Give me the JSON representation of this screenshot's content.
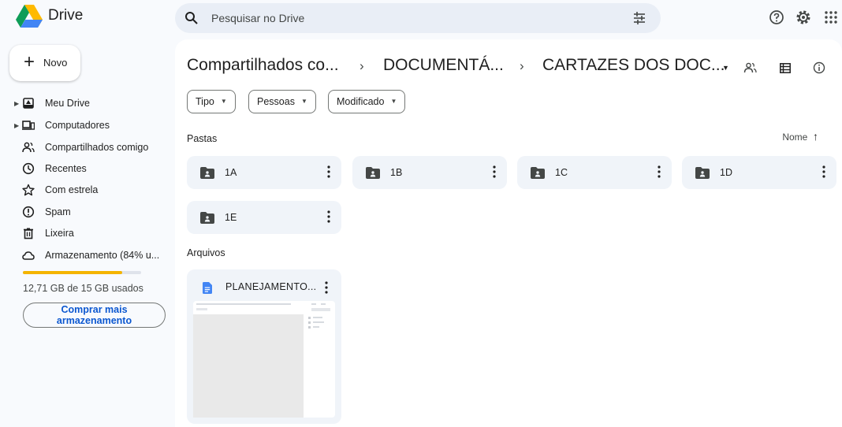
{
  "app": {
    "name": "Drive"
  },
  "search": {
    "placeholder": "Pesquisar no Drive"
  },
  "topbar": {
    "icons": [
      "search-icon",
      "filter-tune-icon",
      "help-icon",
      "settings-icon",
      "apps-grid-icon"
    ]
  },
  "sidebar": {
    "new_label": "Novo",
    "items": [
      {
        "label": "Meu Drive",
        "icon": "my-drive-icon",
        "expandable": true
      },
      {
        "label": "Computadores",
        "icon": "computers-icon",
        "expandable": true
      },
      {
        "label": "Compartilhados comigo",
        "icon": "shared-icon",
        "expandable": false
      },
      {
        "label": "Recentes",
        "icon": "clock-icon",
        "expandable": false
      },
      {
        "label": "Com estrela",
        "icon": "star-icon",
        "expandable": false
      },
      {
        "label": "Spam",
        "icon": "spam-icon",
        "expandable": false
      },
      {
        "label": "Lixeira",
        "icon": "trash-icon",
        "expandable": false
      },
      {
        "label": "Armazenamento (84% u...",
        "icon": "cloud-icon",
        "expandable": false
      }
    ],
    "storage": {
      "used_fraction": 0.84,
      "text": "12,71 GB de 15 GB usados",
      "buy_label": "Comprar mais armazenamento"
    }
  },
  "breadcrumb": [
    {
      "label": "Compartilhados co..."
    },
    {
      "label": "DOCUMENTÁ..."
    },
    {
      "label": "CARTAZES DOS DOC..."
    }
  ],
  "filters": [
    {
      "label": "Tipo"
    },
    {
      "label": "Pessoas"
    },
    {
      "label": "Modificado"
    }
  ],
  "folders_section": {
    "title": "Pastas"
  },
  "sort": {
    "label": "Nome",
    "direction": "↑"
  },
  "folders": [
    {
      "name": "1A"
    },
    {
      "name": "1B"
    },
    {
      "name": "1C"
    },
    {
      "name": "1D"
    },
    {
      "name": "1E"
    }
  ],
  "files_section": {
    "title": "Arquivos"
  },
  "files": [
    {
      "name": "PLANEJAMENTO..."
    }
  ],
  "colors": {
    "accent": "#0b57d0",
    "storage_fill": "#f4b400",
    "doc_blue": "#4285f4",
    "folder_icon": "#444746"
  }
}
